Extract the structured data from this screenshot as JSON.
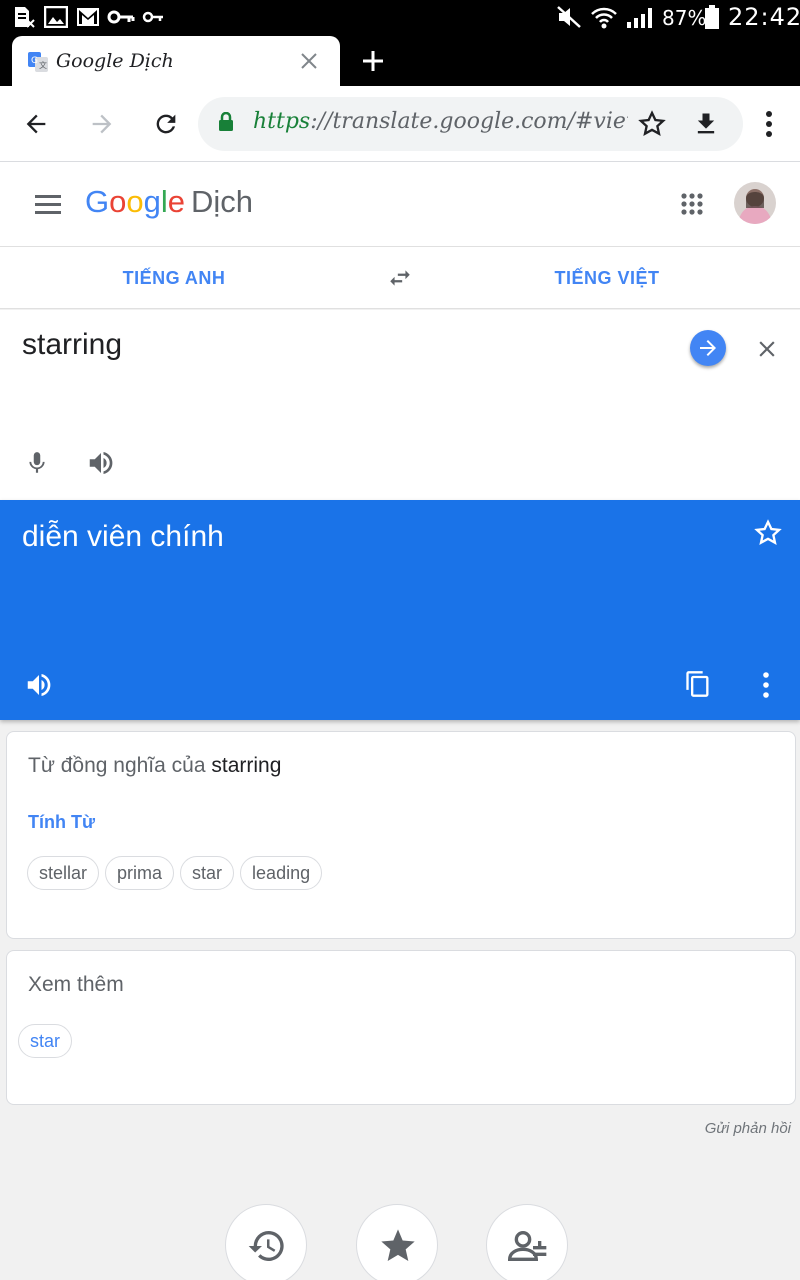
{
  "status_bar": {
    "icons": [
      "sim-card-icon",
      "image-icon",
      "gmail-icon",
      "key-icon",
      "key-icon",
      "mute-icon",
      "wifi-icon",
      "signal-icon",
      "battery-icon"
    ],
    "battery": "87%",
    "time": "22:42"
  },
  "browser": {
    "tab_title": "Google Dịch",
    "url_scheme": "https",
    "url_rest": "://translate.google.com/#view=h"
  },
  "app": {
    "logo_brand": [
      "G",
      "o",
      "o",
      "g",
      "l",
      "e"
    ],
    "logo_suffix": "Dịch"
  },
  "languages": {
    "source": "TIẾNG ANH",
    "target": "TIẾNG VIỆT"
  },
  "input": {
    "text": "starring"
  },
  "output": {
    "text": "diễn viên chính"
  },
  "synonyms": {
    "heading_prefix": "Từ đồng nghĩa của",
    "heading_word": "starring",
    "part_of_speech": "Tính Từ",
    "words": [
      "stellar",
      "prima",
      "star",
      "leading"
    ]
  },
  "see_also": {
    "heading": "Xem thêm",
    "words": [
      "star"
    ]
  },
  "feedback": "Gửi phản hồi",
  "colors": {
    "accent": "#1a73e8",
    "link_blue": "#4285f4",
    "secure_green": "#188038"
  }
}
